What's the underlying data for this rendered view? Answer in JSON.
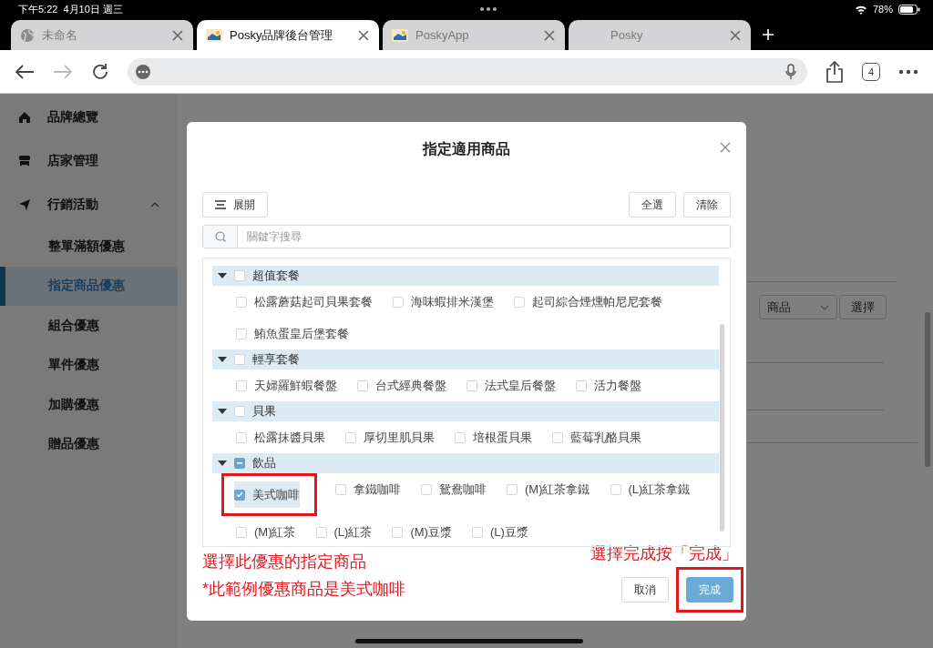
{
  "status_bar": {
    "time": "下午5:22",
    "date": "4月10日 週三",
    "battery": "78%"
  },
  "browser": {
    "tabs": [
      {
        "title": "未命名",
        "selected": false
      },
      {
        "title": "Posky品牌後台管理",
        "selected": true
      },
      {
        "title": "PoskyApp",
        "selected": false
      },
      {
        "title": "Posky",
        "selected": false
      }
    ],
    "forward": {
      "disabled": true
    },
    "tab_count": "4"
  },
  "sidebar": {
    "items": [
      {
        "label": "品牌總覽"
      },
      {
        "label": "店家管理"
      },
      {
        "label": "行銷活動",
        "expanded": true,
        "children": [
          {
            "label": "整單滿額優惠",
            "selected": false
          },
          {
            "label": "指定商品優惠",
            "selected": true
          },
          {
            "label": "組合優惠",
            "selected": false
          },
          {
            "label": "單件優惠",
            "selected": false
          },
          {
            "label": "加購優惠",
            "selected": false
          },
          {
            "label": "贈品優惠",
            "selected": false
          }
        ]
      }
    ]
  },
  "page": {
    "select": "商品",
    "button": "選擇"
  },
  "modal": {
    "title": "指定適用商品",
    "expand_button": "展開",
    "select_all_button": "全選",
    "clear_button": "清除",
    "search": {
      "placeholder": "關鍵字搜尋"
    },
    "categories": [
      {
        "name": "超值套餐",
        "expanded": true,
        "checked": false,
        "indeterminate": false,
        "items": [
          {
            "name": "松露蘑菇起司貝果套餐",
            "checked": false,
            "highlighted": false
          },
          {
            "name": "海味蝦排米漢堡",
            "checked": false,
            "highlighted": false
          },
          {
            "name": "起司綜合煙燻帕尼尼套餐",
            "checked": false,
            "highlighted": false
          },
          {
            "name": "鮪魚蛋皇后堡套餐",
            "checked": false,
            "highlighted": false
          }
        ]
      },
      {
        "name": "輕享套餐",
        "expanded": true,
        "checked": false,
        "indeterminate": false,
        "items": [
          {
            "name": "天婦羅鮮蝦餐盤",
            "checked": false,
            "highlighted": false
          },
          {
            "name": "台式經典餐盤",
            "checked": false,
            "highlighted": false
          },
          {
            "name": "法式皇后餐盤",
            "checked": false,
            "highlighted": false
          },
          {
            "name": "活力餐盤",
            "checked": false,
            "highlighted": false
          }
        ]
      },
      {
        "name": "貝果",
        "expanded": true,
        "checked": false,
        "indeterminate": false,
        "items": [
          {
            "name": "松露抹醬貝果",
            "checked": false,
            "highlighted": false
          },
          {
            "name": "厚切里肌貝果",
            "checked": false,
            "highlighted": false
          },
          {
            "name": "培根蛋貝果",
            "checked": false,
            "highlighted": false
          },
          {
            "name": "藍莓乳酪貝果",
            "checked": false,
            "highlighted": false
          }
        ]
      },
      {
        "name": "飲品",
        "expanded": true,
        "checked": false,
        "indeterminate": true,
        "items": [
          {
            "name": "美式咖啡",
            "checked": true,
            "highlighted": true
          },
          {
            "name": "拿鐵咖啡",
            "checked": false,
            "highlighted": false
          },
          {
            "name": "鴛鴦咖啡",
            "checked": false,
            "highlighted": false
          },
          {
            "name": "(M)紅茶拿鐵",
            "checked": false,
            "highlighted": false
          },
          {
            "name": "(L)紅茶拿鐵",
            "checked": false,
            "highlighted": false
          },
          {
            "name": "(M)紅茶",
            "checked": false,
            "highlighted": false
          },
          {
            "name": "(L)紅茶",
            "checked": false,
            "highlighted": false
          },
          {
            "name": "(M)豆漿",
            "checked": false,
            "highlighted": false
          },
          {
            "name": "(L)豆漿",
            "checked": false,
            "highlighted": false
          }
        ]
      }
    ],
    "cancel_button": "取消",
    "done_button": {
      "label": "完成",
      "highlighted": true
    }
  },
  "annotations": [
    "選擇此優惠的指定商品",
    "*此範例優惠商品是美式咖啡",
    "選擇完成按「完成」"
  ]
}
